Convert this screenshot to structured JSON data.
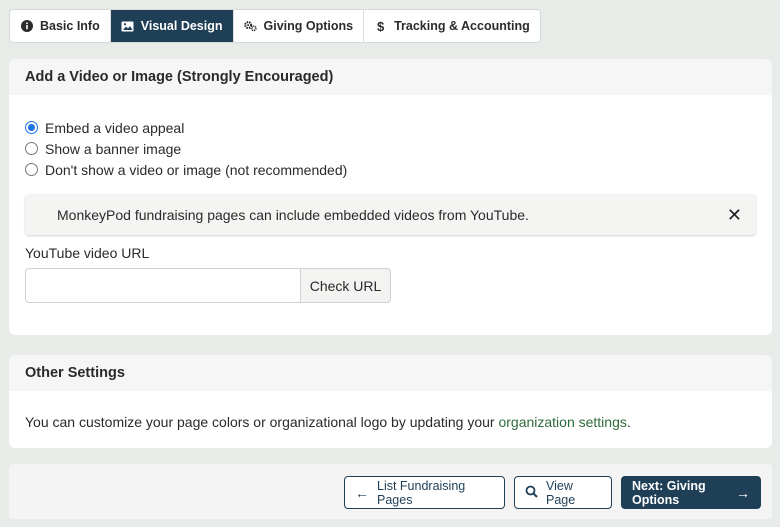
{
  "tabs": [
    {
      "label": "Basic Info",
      "icon": "info-icon"
    },
    {
      "label": "Visual Design",
      "icon": "image-icon"
    },
    {
      "label": "Giving Options",
      "icon": "gears-icon"
    },
    {
      "label": "Tracking & Accounting",
      "icon": "dollar-icon"
    }
  ],
  "active_tab": "Visual Design",
  "media_section": {
    "title": "Add a Video or Image (Strongly Encouraged)",
    "options": [
      {
        "label": "Embed a video appeal",
        "selected": true
      },
      {
        "label": "Show a banner image",
        "selected": false
      },
      {
        "label": "Don't show a video or image (not recommended)",
        "selected": false
      }
    ],
    "notice": "MonkeyPod fundraising pages can include embedded videos from YouTube.",
    "close_glyph": "✕",
    "url_label": "YouTube video URL",
    "url_value": "",
    "url_placeholder": "",
    "check_button": "Check URL"
  },
  "other_section": {
    "title": "Other Settings",
    "text_before": "You can customize your page colors or organizational logo by updating your ",
    "link_text": "organization settings",
    "text_after": "."
  },
  "footer": {
    "list_button": "List Fundraising Pages",
    "view_button": "View Page",
    "next_button": "Next: Giving Options"
  },
  "colors": {
    "primary": "#1f3f57",
    "link": "#2f6b3a",
    "radio_selected": "#1a73e8"
  }
}
